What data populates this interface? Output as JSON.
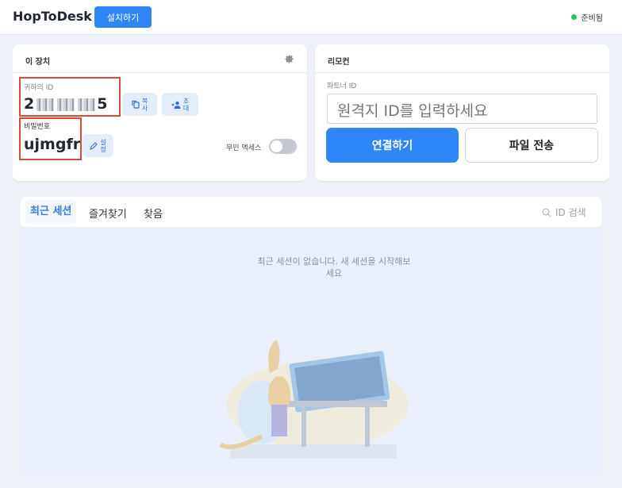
{
  "app": {
    "title": "HopToDesk",
    "install_label": "설치하기",
    "status_text": "준비됨"
  },
  "device": {
    "header": "이 장치",
    "id_label": "귀하의 ID",
    "id_first": "2",
    "id_last": "5",
    "copy_label_1": "복",
    "copy_label_2": "사",
    "invite_label_1": "초",
    "invite_label_2": "대",
    "password_label": "비밀번호",
    "password_value": "ujmgfr",
    "settings_label_1": "설",
    "settings_label_2": "정",
    "unattended_label": "무인 액세스",
    "unattended_on": false
  },
  "remote": {
    "header": "리모컨",
    "partner_label": "파트너 ID",
    "partner_placeholder": "원격지 ID를 입력하세요",
    "connect_label": "연결하기",
    "transfer_label": "파일 전송"
  },
  "sessions": {
    "tabs": [
      "최근 세션",
      "즐겨찾기",
      "찾음"
    ],
    "active_tab": 0,
    "search_placeholder": "ID 검색",
    "empty_line_1": "최근 세션이 없습니다. 새 세션을 시작해보",
    "empty_line_2": "세요"
  },
  "colors": {
    "accent": "#2f86f6",
    "status_ready": "#2dc25f",
    "highlight_box": "#d84a3a"
  }
}
